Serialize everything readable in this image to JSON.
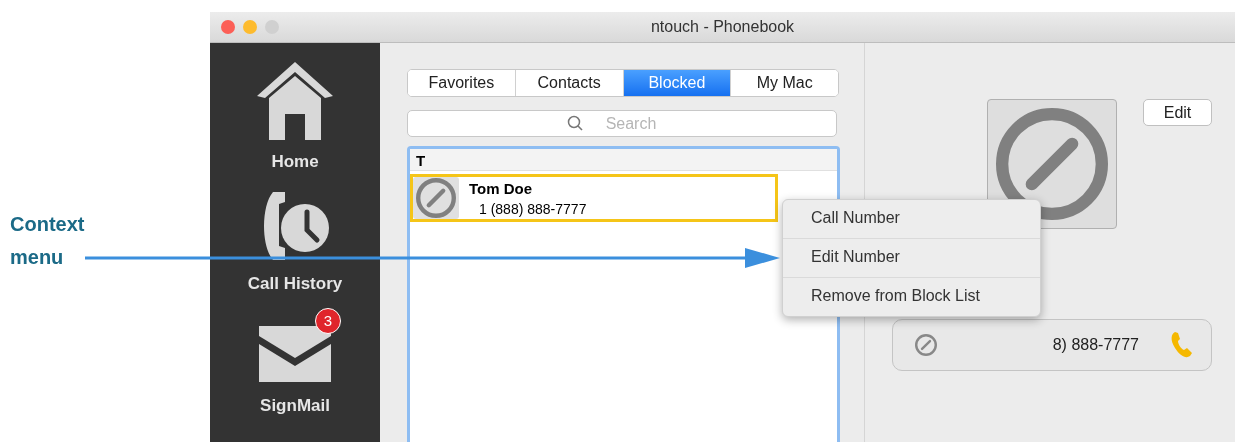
{
  "window": {
    "title": "ntouch - Phonebook"
  },
  "sidebar": {
    "items": [
      {
        "kind": "home",
        "label": "Home"
      },
      {
        "kind": "history",
        "label": "Call History"
      },
      {
        "kind": "mail",
        "label": "SignMail",
        "badge": "3"
      }
    ]
  },
  "tabs": [
    {
      "label": "Favorites",
      "selected": false
    },
    {
      "label": "Contacts",
      "selected": false
    },
    {
      "label": "Blocked",
      "selected": true
    },
    {
      "label": "My Mac",
      "selected": false
    }
  ],
  "search": {
    "placeholder": "Search"
  },
  "list": {
    "sections": [
      {
        "header": "T",
        "contacts": [
          {
            "name": "Tom Doe",
            "number": "1 (888) 888-7777",
            "selected": true
          }
        ]
      }
    ]
  },
  "detail": {
    "edit_button": "Edit",
    "phone": "8) 888-7777"
  },
  "context_menu": {
    "items": [
      "Call Number",
      "Edit Number",
      "Remove from Block List"
    ]
  },
  "annotation": {
    "label": "Context menu"
  }
}
